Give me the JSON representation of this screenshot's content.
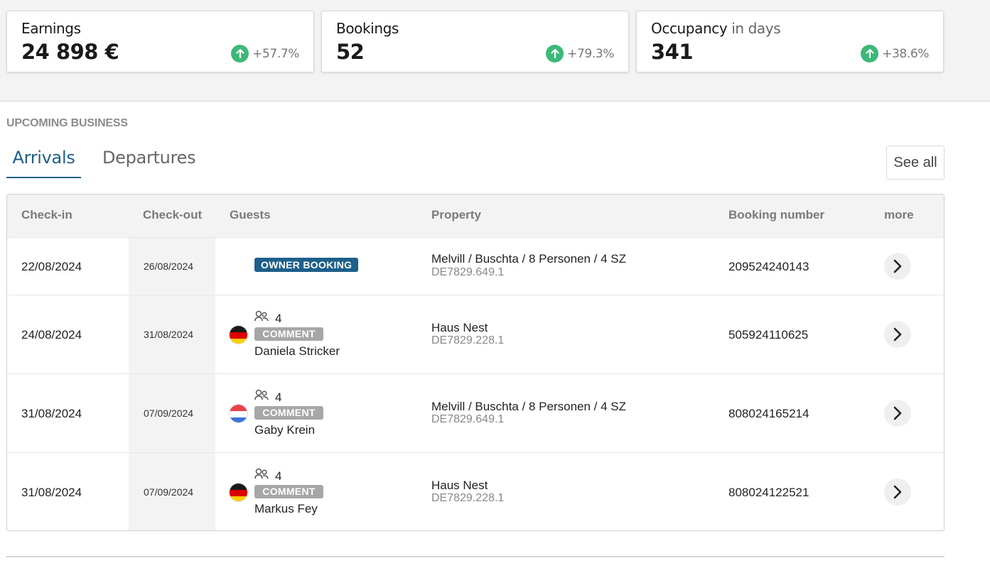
{
  "stats": [
    {
      "title": "Earnings",
      "subtitle": "",
      "value": "24 898 €",
      "trend": "+57.7%"
    },
    {
      "title": "Bookings",
      "subtitle": "",
      "value": "52",
      "trend": "+79.3%"
    },
    {
      "title": "Occupancy",
      "subtitle": "in days",
      "value": "341",
      "trend": "+38.6%"
    }
  ],
  "section": {
    "heading": "UPCOMING BUSINESS"
  },
  "tabs": {
    "arrivals": "Arrivals",
    "departures": "Departures"
  },
  "see_all": "See all",
  "table": {
    "headers": {
      "checkin": "Check-in",
      "checkout": "Check-out",
      "guests": "Guests",
      "property": "Property",
      "booking_number": "Booking number",
      "more": "more"
    },
    "rows": [
      {
        "checkin": "22/08/2024",
        "checkout": "26/08/2024",
        "badge": "OWNER BOOKING",
        "property_name": "Melvill / Buschta / 8 Personen / 4 SZ",
        "property_code": "DE7829.649.1",
        "booking_number": "209524240143"
      },
      {
        "checkin": "24/08/2024",
        "checkout": "31/08/2024",
        "guest_count": "4",
        "comment_label": "COMMENT",
        "guest_name": "Daniela Stricker",
        "flag": "germany",
        "property_name": "Haus Nest",
        "property_code": "DE7829.228.1",
        "booking_number": "505924110625"
      },
      {
        "checkin": "31/08/2024",
        "checkout": "07/09/2024",
        "guest_count": "4",
        "comment_label": "COMMENT",
        "guest_name": "Gaby Krein",
        "flag": "netherlands",
        "property_name": "Melvill / Buschta / 8 Personen / 4 SZ",
        "property_code": "DE7829.649.1",
        "booking_number": "808024165214"
      },
      {
        "checkin": "31/08/2024",
        "checkout": "07/09/2024",
        "guest_count": "4",
        "comment_label": "COMMENT",
        "guest_name": "Markus Fey",
        "flag": "germany",
        "property_name": "Haus Nest",
        "property_code": "DE7829.228.1",
        "booking_number": "808024122521"
      }
    ]
  },
  "colors": {
    "accent": "#1d5f8a",
    "trend_up": "#3cb878",
    "comment_badge": "#a7a7a7",
    "band": "#f3f3f3"
  },
  "icons": {
    "trend": "arrow-up-icon",
    "guests": "people-icon",
    "more": "chevron-right-icon"
  }
}
